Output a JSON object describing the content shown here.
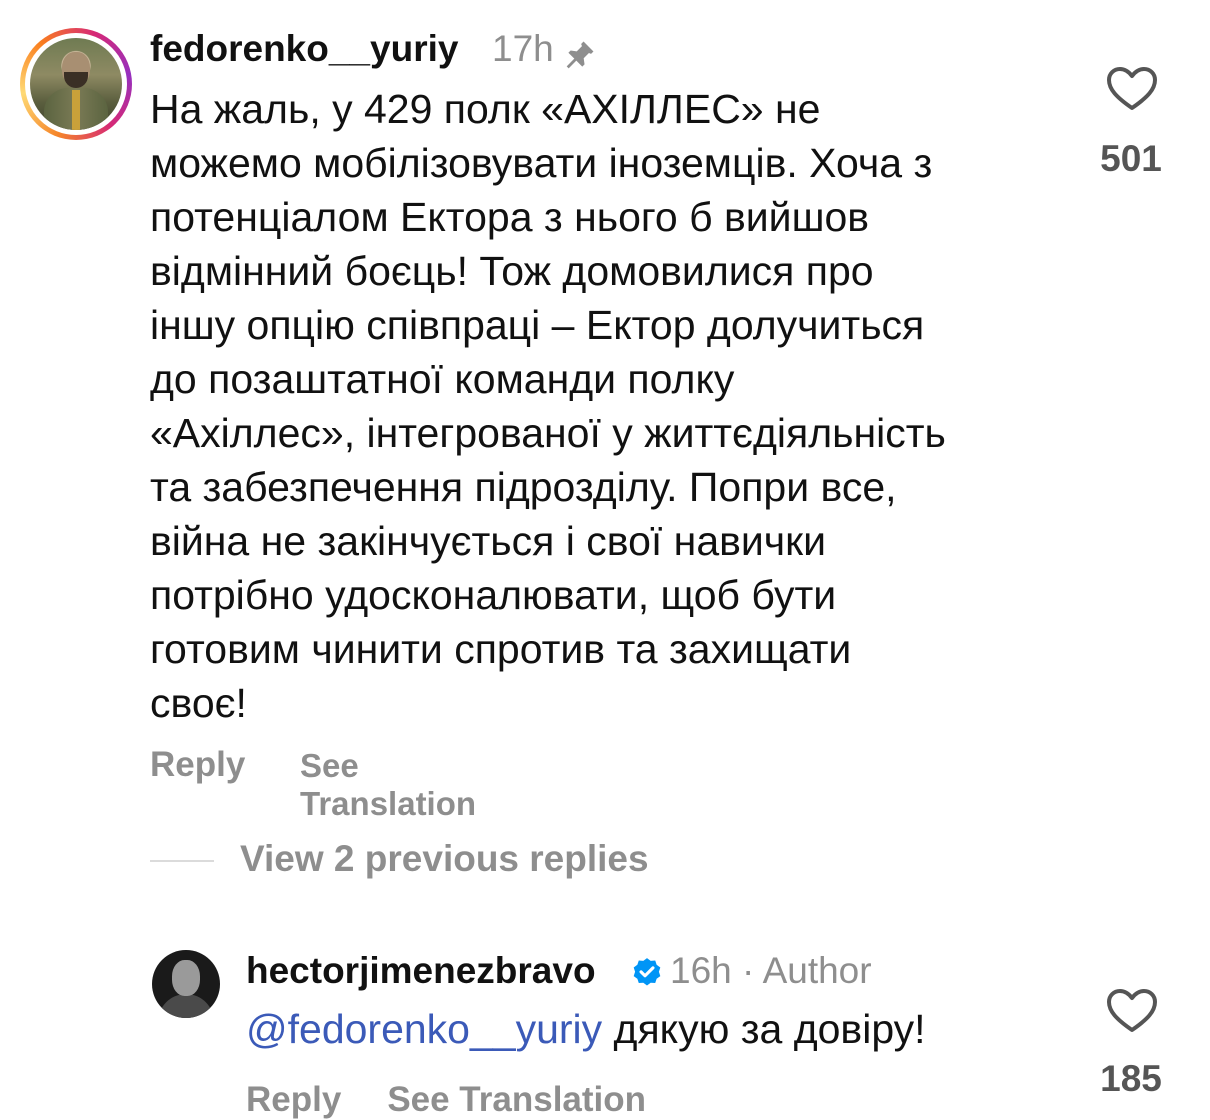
{
  "comment": {
    "username": "fedorenko__yuriy",
    "time": "17h",
    "pinned_icon": "pin-icon",
    "lines": [
      "На жаль, у 429 полк «АХІЛЛЕС» не",
      "можемо мобілізовувати іноземців. Хоча з",
      "потенціалом Ектора з нього б вийшов",
      "відмінний боєць! Тож домовилися про",
      "іншу опцію співпраці – Ектор долучиться",
      "до позаштатної команди полку",
      "«Ахіллес», інтегрованої у життєдіяльність",
      "та забезпечення підрозділу. Попри все,",
      "війна не закінчується і свої навички",
      "потрібно удосконалювати, щоб бути",
      "готовим чинити спротив та захищати",
      "своє!"
    ],
    "reply_label": "Reply",
    "translate_label": "See Translation",
    "likes": "501"
  },
  "view_replies_label": "View 2 previous replies",
  "reply": {
    "username": "hectorjimenezbravo",
    "time_author": "16h · Author",
    "mention": "@fedorenko__yuriy",
    "text": " дякую за довіру!",
    "likes": "185",
    "reply_label": "Reply",
    "translate_label": "See Translation"
  },
  "colors": {
    "accent_link": "#3b5ab8",
    "muted": "#8e8e8e",
    "verified": "#0095f6"
  }
}
